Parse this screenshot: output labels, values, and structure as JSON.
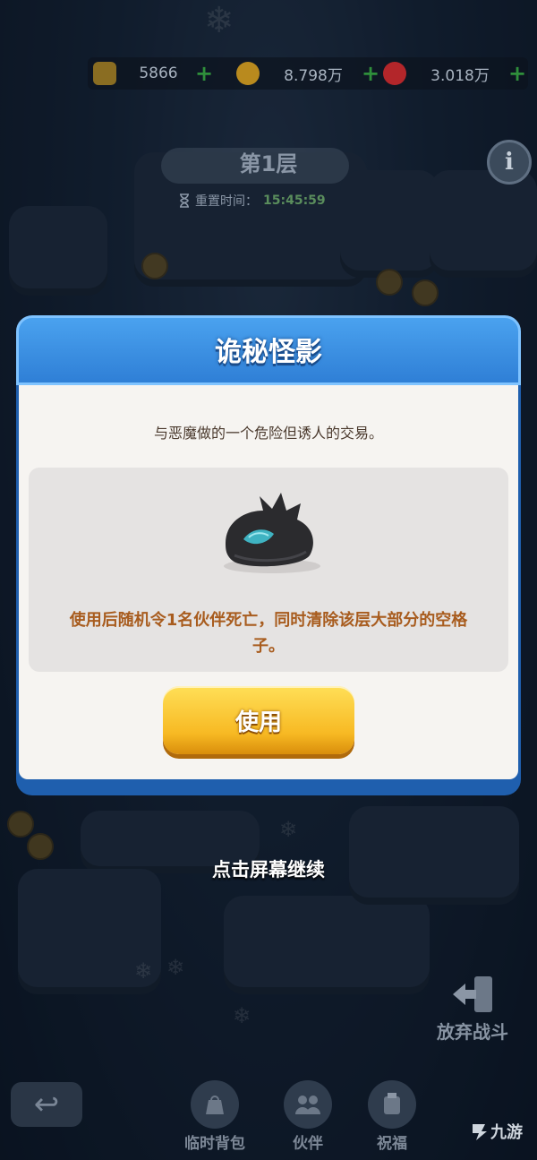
{
  "resources": [
    {
      "name": "gem-bar",
      "value": "5866",
      "color": "#8a6d22"
    },
    {
      "name": "gold-coin",
      "value": "8.798万",
      "color": "#b98a1e"
    },
    {
      "name": "red-gem",
      "value": "3.018万",
      "color": "#b3262a"
    }
  ],
  "floor": {
    "title": "第1层",
    "reset_label": "重置时间：",
    "reset_time": "15:45:59"
  },
  "dialog": {
    "title": "诡秘怪影",
    "subtitle": "与恶魔做的一个危险但诱人的交易。",
    "description": "使用后随机令1名伙伴死亡，同时清除该层大部分的空格子。",
    "use_button": "使用"
  },
  "continue_text": "点击屏幕继续",
  "abandon_label": "放弃战斗",
  "bottom_nav": [
    {
      "label": "临时背包",
      "icon": "bag-icon"
    },
    {
      "label": "伙伴",
      "icon": "companions-icon"
    },
    {
      "label": "祝福",
      "icon": "blessing-icon"
    }
  ],
  "watermark": "九游",
  "colors": {
    "dialog_header": "#2f7fd6",
    "button": "#f7b923",
    "description_text": "#a85c1e"
  }
}
